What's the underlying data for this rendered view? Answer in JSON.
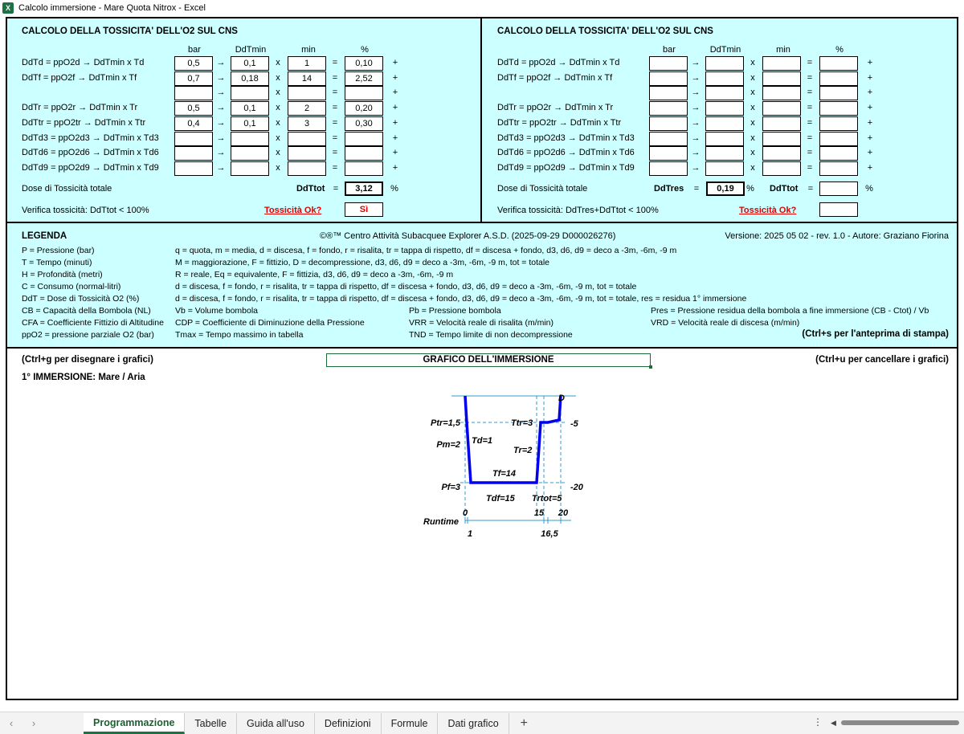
{
  "window": {
    "title": "Calcolo immersione - Mare Quota Nitrox - Excel",
    "app_icon": "excel-icon"
  },
  "panel_left": {
    "title": "CALCOLO DELLA TOSSICITA' DELL'O2 SUL CNS",
    "headers": [
      "bar",
      "DdTmin",
      "min",
      "%"
    ],
    "rows": [
      {
        "label": "DdTd = ppO2d → DdTmin x Td",
        "bar": "0,5",
        "ddt": "0,1",
        "min": "1",
        "pct": "0,10"
      },
      {
        "label": "DdTf = ppO2f → DdTmin x Tf",
        "bar": "0,7",
        "ddt": "0,18",
        "min": "14",
        "pct": "2,52"
      },
      {
        "label": "",
        "bar": "",
        "ddt": "",
        "min": "",
        "pct": ""
      },
      {
        "label": "DdTr = ppO2r → DdTmin x Tr",
        "bar": "0,5",
        "ddt": "0,1",
        "min": "2",
        "pct": "0,20"
      },
      {
        "label": "DdTtr = ppO2tr → DdTmin x Ttr",
        "bar": "0,4",
        "ddt": "0,1",
        "min": "3",
        "pct": "0,30"
      },
      {
        "label": "DdTd3 = ppO2d3 → DdTmin x Td3",
        "bar": "",
        "ddt": "",
        "min": "",
        "pct": ""
      },
      {
        "label": "DdTd6 = ppO2d6 → DdTmin x Td6",
        "bar": "",
        "ddt": "",
        "min": "",
        "pct": ""
      },
      {
        "label": "DdTd9 = ppO2d9 → DdTmin x Td9",
        "bar": "",
        "ddt": "",
        "min": "",
        "pct": ""
      }
    ],
    "dose_label": "Dose di Tossicità totale",
    "ddtot_label": "DdTtot",
    "ddtot_value": "3,12",
    "pct_sign": "%",
    "verify_label": "Verifica tossicità: DdTtot < 100%",
    "link_label": "Tossicità Ok?",
    "result": "Sì"
  },
  "panel_right": {
    "title": "CALCOLO DELLA TOSSICITA' DELL'O2 SUL CNS",
    "headers": [
      "bar",
      "DdTmin",
      "min",
      "%"
    ],
    "rows": [
      {
        "label": "DdTd = ppO2d → DdTmin x Td"
      },
      {
        "label": "DdTf = ppO2f → DdTmin x Tf"
      },
      {
        "label": ""
      },
      {
        "label": "DdTr = ppO2r → DdTmin x Tr"
      },
      {
        "label": "DdTtr = ppO2tr → DdTmin x Ttr"
      },
      {
        "label": "DdTd3 = ppO2d3 → DdTmin x Td3"
      },
      {
        "label": "DdTd6 = ppO2d6 → DdTmin x Td6"
      },
      {
        "label": "DdTd9 = ppO2d9 → DdTmin x Td9"
      }
    ],
    "dose_label": "Dose di Tossicità totale",
    "ddtres_label": "DdTres",
    "ddtres_value": "0,19",
    "ddtot_label": "DdTtot",
    "ddtot_value": "",
    "pct_sign": "%",
    "verify_label": "Verifica tossicità: DdTres+DdTtot < 100%",
    "link_label": "Tossicità Ok?",
    "result": ""
  },
  "legend": {
    "title": "LEGENDA",
    "copyright": "©®™ Centro Attività Subacquee Explorer A.S.D. (2025-09-29 D000026276)",
    "version": "Versione: 2025 05 02 - rev. 1.0 - Autore: Graziano Fiorina",
    "lines": [
      {
        "left": "P = Pressione (bar)",
        "right": "q = quota, m = media, d = discesa, f = fondo, r = risalita, tr = tappa di rispetto, df = discesa + fondo, d3, d6, d9 = deco a -3m, -6m, -9 m"
      },
      {
        "left": "T = Tempo (minuti)",
        "right": "M = maggiorazione, F = fittizio, D = decompressione, d3, d6, d9 = deco a -3m, -6m, -9 m, tot = totale"
      },
      {
        "left": "H = Profondità (metri)",
        "right": "R = reale, Eq = equivalente, F = fittizia, d3, d6, d9 = deco a -3m, -6m, -9 m"
      },
      {
        "left": "C = Consumo (normal-litri)",
        "right": "d = discesa, f = fondo, r = risalita, tr = tappa di rispetto, df = discesa + fondo, d3, d6, d9 = deco a -3m, -6m, -9 m, tot = totale"
      },
      {
        "left": "DdT = Dose di Tossicità O2 (%)",
        "right": "d = discesa, f = fondo, r = risalita, tr = tappa di rispetto, df = discesa + fondo, d3, d6, d9 = deco a -3m, -6m, -9 m, tot = totale, res = residua 1° immersione"
      }
    ],
    "grid": [
      [
        "CB = Capacità della Bombola (NL)",
        "Vb = Volume bombola",
        "Pb = Pressione bombola",
        "Pres = Pressione residua della bombola a fine immersione (CB - Ctot) / Vb"
      ],
      [
        "CFA = Coefficiente Fittizio di Altitudine",
        "CDP = Coefficiente di Diminuzione della Pressione",
        "VRR = Velocità reale di risalita (m/min)",
        "VRD = Velocità reale di discesa (m/min)"
      ],
      [
        "ppO2 = pressione parziale O2 (bar)",
        "Tmax = Tempo massimo in tabella",
        "TND = Tempo limite di non decompressione",
        "(Ctrl+s per l'anteprima di stampa)"
      ]
    ]
  },
  "chart_section": {
    "hint_left": "(Ctrl+g per disegnare i grafici)",
    "title": "GRAFICO DELL'IMMERSIONE",
    "hint_right": "(Ctrl+u per cancellare i grafici)",
    "dive_label": "1° IMMERSIONE: Mare / Aria"
  },
  "dive_profile": {
    "labels": {
      "D": "D",
      "ptr": "Ptr=1,5",
      "pm": "Pm=2",
      "pf": "Pf=3",
      "td": "Td=1",
      "tr": "Tr=2",
      "ttr": "Ttr=3",
      "tf": "Tf=14",
      "tdf": "Tdf=15",
      "trtot": "Trtot=5",
      "d5": "-5",
      "d20": "-20",
      "t0": "0",
      "t15": "15",
      "t20": "20",
      "runtime": "Runtime",
      "r1": "1",
      "r165": "16,5"
    },
    "colors": {
      "profile": "#0000ee",
      "guide": "#3399cc"
    }
  },
  "tabs": {
    "nav_prev": "‹",
    "nav_next": "›",
    "items": [
      "Programmazione",
      "Tabelle",
      "Guida all'uso",
      "Definizioni",
      "Formule",
      "Dati grafico"
    ],
    "active": 0,
    "add": "+"
  }
}
